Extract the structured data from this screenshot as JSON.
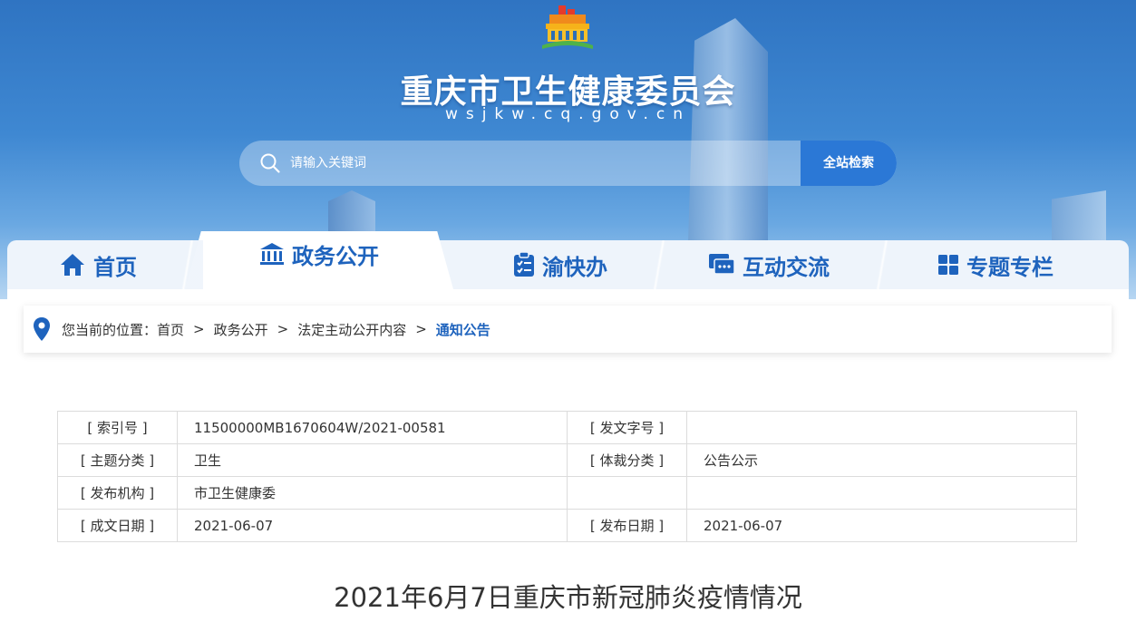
{
  "header": {
    "site_title": "重庆市卫生健康委员会",
    "site_domain": "wsjkw.cq.gov.cn"
  },
  "search": {
    "placeholder": "请输入关键词",
    "button_label": "全站检索"
  },
  "nav": {
    "items": [
      {
        "label": "首页",
        "icon": "home-icon"
      },
      {
        "label": "政务公开",
        "icon": "government-building-icon",
        "active": true
      },
      {
        "label": "渝快办",
        "icon": "checklist-icon"
      },
      {
        "label": "互动交流",
        "icon": "chat-icon"
      },
      {
        "label": "专题专栏",
        "icon": "grid-icon"
      }
    ]
  },
  "breadcrumb": {
    "prefix": "您当前的位置：",
    "items": [
      "首页",
      "政务公开",
      "法定主动公开内容"
    ],
    "current": "通知公告",
    "separator": ">"
  },
  "meta": {
    "rows": [
      {
        "k1": "[ 索引号 ]",
        "v1": "11500000MB1670604W/2021-00581",
        "k2": "[ 发文字号 ]",
        "v2": ""
      },
      {
        "k1": "[ 主题分类 ]",
        "v1": "卫生",
        "k2": "[ 体裁分类 ]",
        "v2": "公告公示"
      },
      {
        "k1": "[ 发布机构 ]",
        "v1": "市卫生健康委",
        "k2": "",
        "v2": ""
      },
      {
        "k1": "[ 成文日期 ]",
        "v1": "2021-06-07",
        "k2": "[ 发布日期 ]",
        "v2": "2021-06-07"
      }
    ]
  },
  "article": {
    "title": "2021年6月7日重庆市新冠肺炎疫情情况"
  },
  "colors": {
    "primary": "#1e63bd",
    "search_button": "#2b78d6"
  }
}
